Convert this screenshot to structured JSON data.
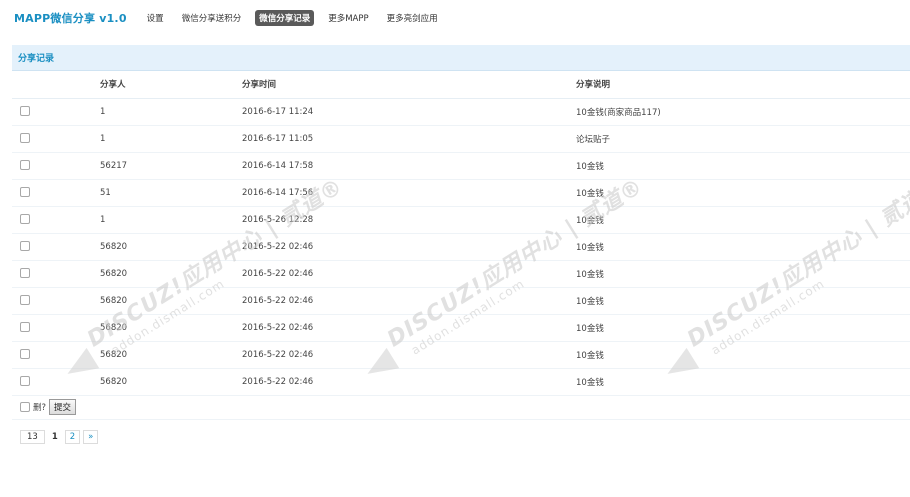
{
  "header": {
    "app_title": "MAPP微信分享 v1.0",
    "nav": [
      {
        "label": "设置",
        "active": false
      },
      {
        "label": "微信分享送积分",
        "active": false
      },
      {
        "label": "微信分享记录",
        "active": true
      },
      {
        "label": "更多MAPP",
        "active": false
      },
      {
        "label": "更多亮剑应用",
        "active": false
      }
    ]
  },
  "panel": {
    "title": "分享记录",
    "columns": [
      "分享人",
      "分享时间",
      "分享说明"
    ],
    "rows": [
      {
        "user": "1",
        "time": "2016-6-17 11:24",
        "desc": "10金钱(商家商品117)"
      },
      {
        "user": "1",
        "time": "2016-6-17 11:05",
        "desc": "论坛贴子"
      },
      {
        "user": "56217",
        "time": "2016-6-14 17:58",
        "desc": "10金钱"
      },
      {
        "user": "51",
        "time": "2016-6-14 17:56",
        "desc": "10金钱"
      },
      {
        "user": "1",
        "time": "2016-5-26 12:28",
        "desc": "10金钱"
      },
      {
        "user": "56820",
        "time": "2016-5-22 02:46",
        "desc": "10金钱"
      },
      {
        "user": "56820",
        "time": "2016-5-22 02:46",
        "desc": "10金钱"
      },
      {
        "user": "56820",
        "time": "2016-5-22 02:46",
        "desc": "10金钱"
      },
      {
        "user": "56820",
        "time": "2016-5-22 02:46",
        "desc": "10金钱"
      },
      {
        "user": "56820",
        "time": "2016-5-22 02:46",
        "desc": "10金钱"
      },
      {
        "user": "56820",
        "time": "2016-5-22 02:46",
        "desc": "10金钱"
      }
    ],
    "delete_label": "删?",
    "submit_label": "提交"
  },
  "pager": {
    "total": "13",
    "current": "1",
    "next_page": "2",
    "next_icon": "»"
  },
  "watermark": {
    "line1": "DISCUZ!应用中心 | 贰道®",
    "line2": "addon.dismall.com"
  },
  "colors": {
    "accent": "#1a8fc2",
    "panel_header_bg": "#e4f1fb",
    "active_tab_bg": "#5a5a5a"
  }
}
